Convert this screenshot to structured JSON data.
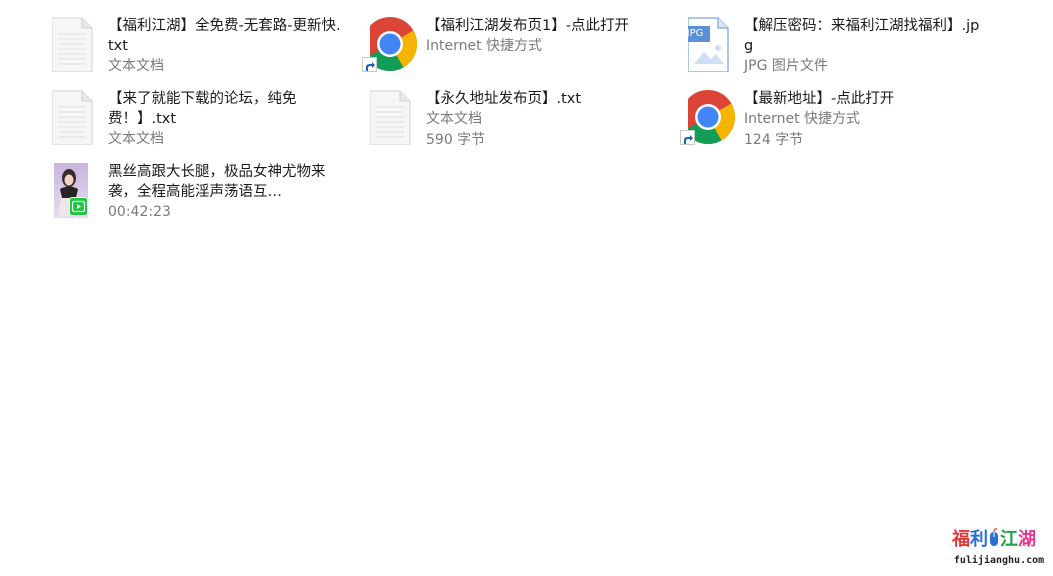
{
  "files": [
    {
      "name": "【福利江湖】全免费-无套路-更新快.txt",
      "meta": "文本文档",
      "icon": "txt-file-icon"
    },
    {
      "name": "【福利江湖发布页1】-点此打开",
      "meta": "Internet 快捷方式",
      "icon": "chrome-icon"
    },
    {
      "name": "【解压密码：来福利江湖找福利】.jpg",
      "meta": "JPG 图片文件",
      "icon": "jpg-file-icon",
      "badge": "JPG"
    },
    {
      "name": "【来了就能下载的论坛，纯免费！】.txt",
      "meta": "文本文档",
      "icon": "txt-file-icon"
    },
    {
      "name": "【永久地址发布页】.txt",
      "meta": "文本文档",
      "size": "590 字节",
      "icon": "txt-file-icon"
    },
    {
      "name": "【最新地址】-点此打开",
      "meta": "Internet 快捷方式",
      "size": "124 字节",
      "icon": "chrome-icon"
    },
    {
      "name": "黑丝高跟大长腿，极品女神尤物来袭，全程高能淫声荡语互…",
      "meta": "00:42:23",
      "icon": "video-thumbnail-icon"
    }
  ],
  "watermark": {
    "chars": [
      "福",
      "利",
      "江",
      "湖"
    ],
    "url": "fulijianghu.com"
  },
  "colors": {
    "text": "#1a1a1a",
    "meta": "#7a7a7a",
    "chrome_red": "#db4437",
    "chrome_green": "#0f9d58",
    "chrome_yellow": "#f4b400",
    "chrome_blue": "#4285f4",
    "jpg_badge": "#5b8fd8",
    "play_badge": "#19c93b"
  }
}
